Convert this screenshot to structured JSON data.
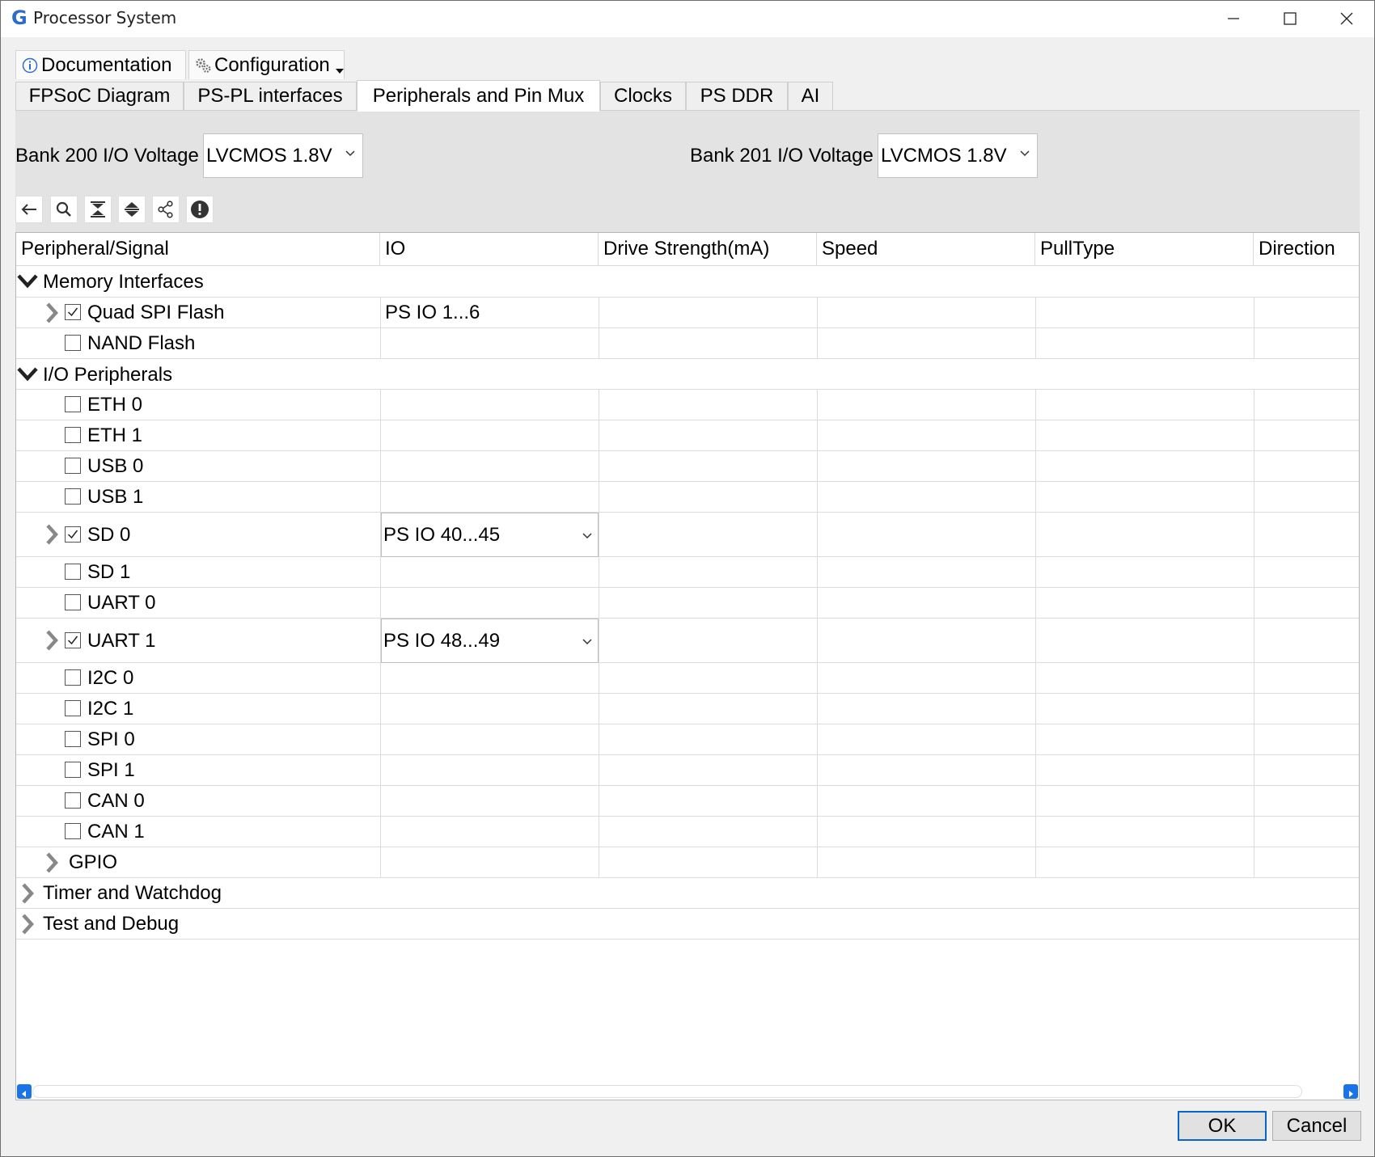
{
  "window": {
    "title": "Processor System",
    "app_icon_letter": "G",
    "controls": [
      "minimize-icon",
      "maximize-icon",
      "close-icon"
    ]
  },
  "top_tabs": [
    {
      "label": "Documentation",
      "icon": "info-icon"
    },
    {
      "label": "Configuration",
      "icon": "gears-icon"
    }
  ],
  "tabs": [
    {
      "label": "FPSoC Diagram",
      "active": false
    },
    {
      "label": "PS-PL interfaces",
      "active": false
    },
    {
      "label": "Peripherals and Pin Mux",
      "active": true
    },
    {
      "label": "Clocks",
      "active": false
    },
    {
      "label": "PS DDR",
      "active": false
    },
    {
      "label": "AI",
      "active": false
    }
  ],
  "voltage": {
    "bank200": {
      "label": "Bank 200 I/O Voltage",
      "value": "LVCMOS 1.8V"
    },
    "bank201": {
      "label": "Bank 201 I/O Voltage",
      "value": "LVCMOS 1.8V"
    }
  },
  "toolbar": [
    "back-arrow-icon",
    "search-icon",
    "collapse-all-icon",
    "expand-all-icon",
    "share-icon",
    "info-alert-icon"
  ],
  "table": {
    "headers": [
      "Peripheral/Signal",
      "IO",
      "Drive Strength(mA)",
      "Speed",
      "PullType",
      "Direction"
    ],
    "rows": [
      {
        "label": "Memory Interfaces",
        "io": ""
      },
      {
        "label": "Quad SPI Flash",
        "io": "PS IO 1...6"
      },
      {
        "label": "NAND Flash",
        "io": ""
      },
      {
        "label": "I/O Peripherals",
        "io": ""
      },
      {
        "label": "ETH 0",
        "io": ""
      },
      {
        "label": "ETH 1",
        "io": ""
      },
      {
        "label": "USB 0",
        "io": ""
      },
      {
        "label": "USB 1",
        "io": ""
      },
      {
        "label": "SD 0",
        "io": "PS IO 40...45"
      },
      {
        "label": "SD 1",
        "io": ""
      },
      {
        "label": "UART 0",
        "io": ""
      },
      {
        "label": "UART 1",
        "io": "PS IO 48...49"
      },
      {
        "label": "I2C 0",
        "io": ""
      },
      {
        "label": "I2C 1",
        "io": ""
      },
      {
        "label": "SPI 0",
        "io": ""
      },
      {
        "label": "SPI 1",
        "io": ""
      },
      {
        "label": "CAN 0",
        "io": ""
      },
      {
        "label": "CAN 1",
        "io": ""
      },
      {
        "label": "GPIO",
        "io": ""
      },
      {
        "label": "Timer and Watchdog",
        "io": ""
      },
      {
        "label": "Test and Debug",
        "io": ""
      }
    ]
  },
  "buttons": {
    "ok": "OK",
    "cancel": "Cancel"
  },
  "colors": {
    "accent": "#0a64c8",
    "scroll_button": "#1a73e8"
  }
}
